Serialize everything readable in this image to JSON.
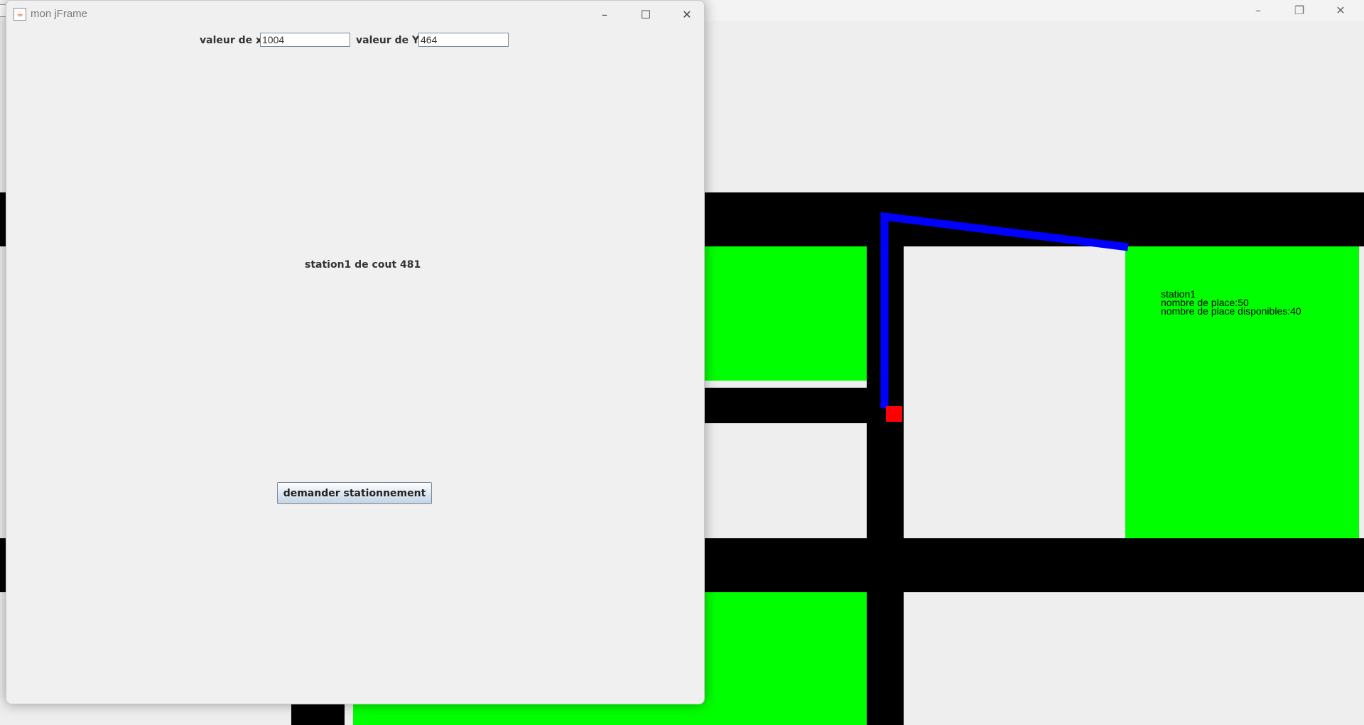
{
  "background_window": {
    "controls": {
      "minimize": "–",
      "restore": "❐",
      "close": "✕"
    }
  },
  "map": {
    "colors": {
      "road": "#000000",
      "parking": "#00ff00",
      "route": "#0000ff",
      "position_marker": "#ff0000"
    },
    "station_info": {
      "name": "station1",
      "places": "nombre de place:50",
      "available": "nombre de place disponibles:40"
    }
  },
  "frame": {
    "title": "mon jFrame",
    "icon": "java-icon",
    "controls": {
      "minimize": "–",
      "maximize": "☐",
      "close": "✕"
    },
    "x_label": "valeur de x",
    "x_value": "1004",
    "y_label": "valeur de Y",
    "y_value": "464",
    "result_text": "station1 de cout 481",
    "request_button_label": "demander stationnement"
  }
}
